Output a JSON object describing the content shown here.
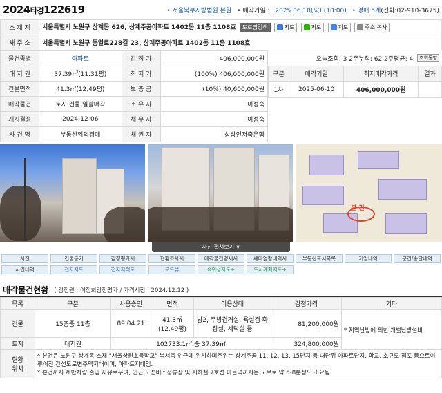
{
  "header": {
    "case_year": "2024",
    "case_type": "타경",
    "case_number": "122619",
    "court": "• 서울북부지방법원 본원",
    "sale_date_label": "• 매각기일 :",
    "sale_date": "2025.06.10(火) (10:00)",
    "dept": "• 경매 5계",
    "phone": "(전화:02-910-3675)"
  },
  "info": {
    "location_label": "소 재 지",
    "location": "서울특별시 노원구 상계동 626, 상계주공아파트 1402동 11층 1108호",
    "btn_road": "도로명검색",
    "btn_map1": "지도",
    "btn_map2": "지도",
    "btn_map3": "지도",
    "btn_copy": "주소 복사",
    "new_addr_label": "새 주 소",
    "new_addr": "서울특별시 노원구 동일로228길 23, 상계주공아파트 1402동 11층 1108호",
    "rows": [
      {
        "l1": "물건종별",
        "v1": "아파트",
        "l2": "감 정 가",
        "v2": "406,000,000원"
      },
      {
        "l1": "대 지 권",
        "v1": "37.39㎡(11.31평)",
        "l2": "최 저 가",
        "v2": "(100%) 406,000,000원"
      },
      {
        "l1": "건물면적",
        "v1": "41.3㎡(12.49평)",
        "l2": "보 증 금",
        "v2": "(10%) 40,600,000원"
      },
      {
        "l1": "매각물건",
        "v1": "토지·건물 일괄매각",
        "l2": "소 유 자",
        "v2": "이정숙"
      },
      {
        "l1": "개시결정",
        "v1": "2024-12-06",
        "l2": "채 무 자",
        "v2": "이정숙"
      },
      {
        "l1": "사 건 명",
        "v1": "부동산임의경매",
        "l2": "채 권 자",
        "v2": "상상인저축은행"
      }
    ]
  },
  "stats": {
    "text": "오늘조회: 3  2주누적: 62  2주평균: 4",
    "button": "조회동향"
  },
  "history": {
    "headers": [
      "구분",
      "매각기일",
      "최저매각가격",
      "결과"
    ],
    "rows": [
      [
        "1차",
        "2025-06-10",
        "406,000,000원",
        ""
      ]
    ]
  },
  "photos": {
    "bar_label": "사진 펼쳐보기 ∨",
    "map_label": "본 건"
  },
  "nav": {
    "row1": [
      "사진",
      "건물등기",
      "감정평가서",
      "현황조사서",
      "매각물건명세서",
      "세대열람내역서",
      "부동산표시목록",
      "기일내역",
      "문건/송달내역"
    ],
    "row2": [
      "사건내역",
      "전자지도",
      "전자지적도",
      "로드뷰",
      "※위성지도+",
      "도시계획지도+"
    ]
  },
  "section": {
    "title": "매각물건현황",
    "sub": "( 감정원 : 이정회감정평가 / 가격시점 : 2024.12.12 )"
  },
  "goods": {
    "headers": [
      "목록",
      "구분",
      "사용승인",
      "면적",
      "이용상태",
      "감정가격",
      "기타"
    ],
    "building": {
      "label": "건물",
      "kind": "15층중 11층",
      "approval": "89.04.21",
      "area": "41.3㎡\n(12.49평)",
      "use": "방2, 주방겸거실, 욕실겸 화장실, 세탁실 등",
      "price": "81,200,000원",
      "etc": "* 지역난방에 의한 개별난방설비"
    },
    "land": {
      "label": "토지",
      "kind": "대지권",
      "area": "102733.1㎡ 중 37.39㎡",
      "price": "324,800,000원"
    },
    "status_label": "현황\n위치",
    "notes": [
      "* 본건은 노원구 상계동 소재 \"서울상원초등학교\" 북서측 인근에 위치하며주위는 상계주공 11, 12, 13, 15단지 등 대단위 아파트단지, 학교, 소규모 점포 등으로이루어진 간선도로변주택지대이며, 아파트지대임.",
      "* 본건까지 제반차량 출입 자유로우며, 인근 노선버스정류장 및 지하철 7호선 마들역까지는 도보로 약 5-8분정도 소요됨."
    ]
  }
}
